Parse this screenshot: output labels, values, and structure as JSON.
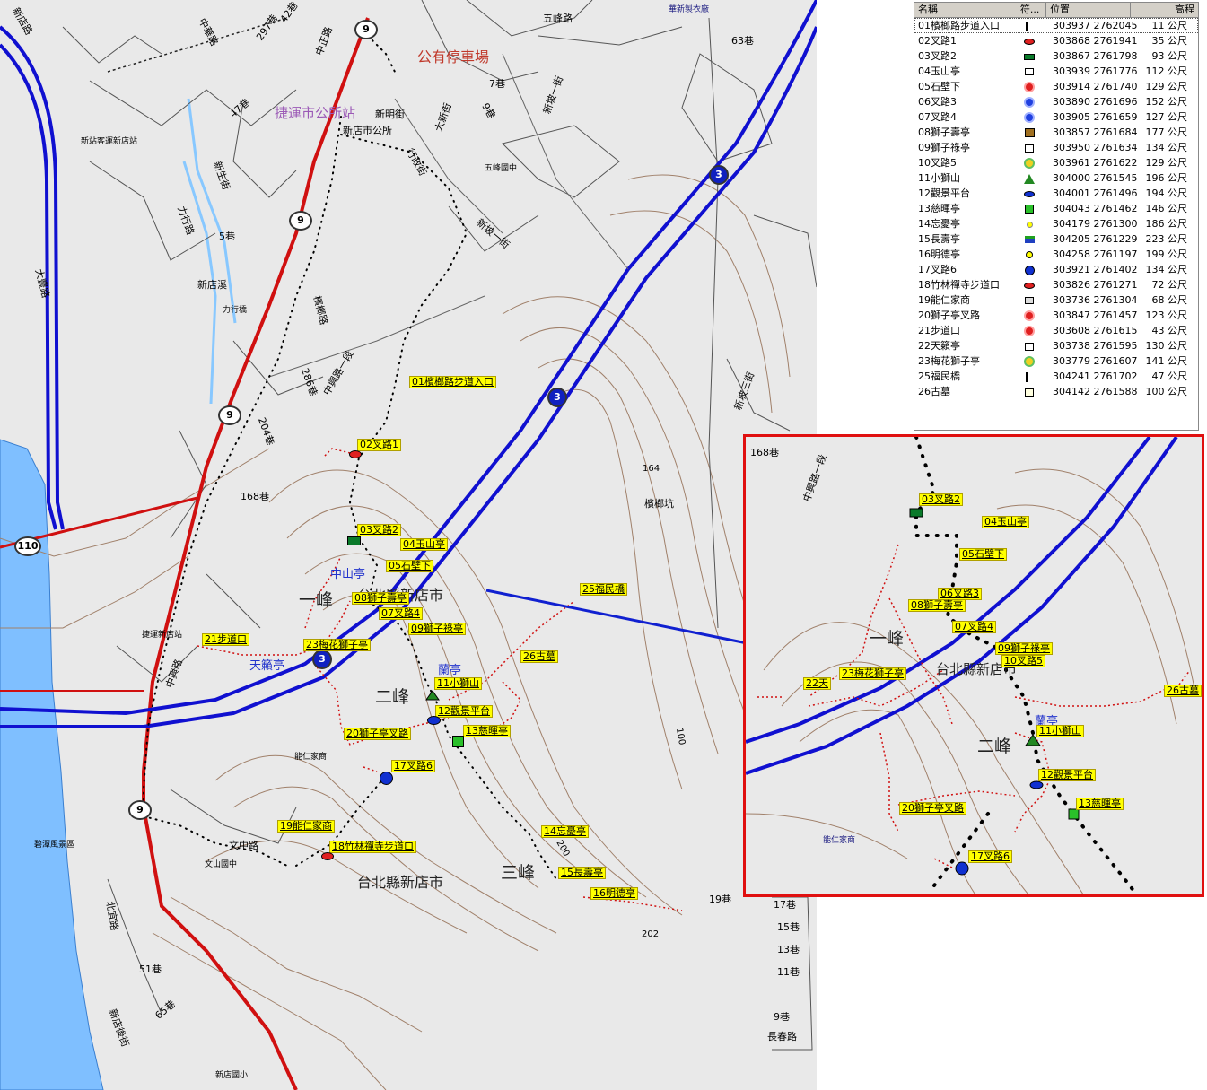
{
  "legend": {
    "headers": [
      "名稱",
      "符...",
      "位置",
      "高程"
    ],
    "rows": [
      {
        "name": "01檳榔路步道入口",
        "pos": "303937 2762045",
        "elev": "11 公尺",
        "icon": "hiker-icon"
      },
      {
        "name": "02叉路1",
        "pos": "303868 2761941",
        "elev": "35 公尺",
        "icon": "red-oval-icon"
      },
      {
        "name": "03叉路2",
        "pos": "303867 2761798",
        "elev": "93 公尺",
        "icon": "green-rect-icon"
      },
      {
        "name": "04玉山亭",
        "pos": "303939 2761776",
        "elev": "112 公尺",
        "icon": "pavilion-icon"
      },
      {
        "name": "05石壁下",
        "pos": "303914 2761740",
        "elev": "129 公尺",
        "icon": "red-sun-icon"
      },
      {
        "name": "06叉路3",
        "pos": "303890 2761696",
        "elev": "152 公尺",
        "icon": "blue-sun-icon"
      },
      {
        "name": "07叉路4",
        "pos": "303905 2761659",
        "elev": "127 公尺",
        "icon": "blue-sun-icon"
      },
      {
        "name": "08獅子壽亭",
        "pos": "303857 2761684",
        "elev": "177 公尺",
        "icon": "house-icon"
      },
      {
        "name": "09獅子祿亭",
        "pos": "303950 2761634",
        "elev": "134 公尺",
        "icon": "temple-icon"
      },
      {
        "name": "10叉路5",
        "pos": "303961 2761622",
        "elev": "129 公尺",
        "icon": "green-sun-icon"
      },
      {
        "name": "11小獅山",
        "pos": "304000 2761545",
        "elev": "196 公尺",
        "icon": "green-triangle-icon"
      },
      {
        "name": "12觀景平台",
        "pos": "304001 2761496",
        "elev": "194 公尺",
        "icon": "blue-oval-icon"
      },
      {
        "name": "13慈暉亭",
        "pos": "304043 2761462",
        "elev": "146 公尺",
        "icon": "green-cube-icon"
      },
      {
        "name": "14忘憂亭",
        "pos": "304179 2761300",
        "elev": "186 公尺",
        "icon": "yellow-dot-icon"
      },
      {
        "name": "15長壽亭",
        "pos": "304205 2761229",
        "elev": "223 公尺",
        "icon": "green-house-icon"
      },
      {
        "name": "16明德亭",
        "pos": "304258 2761197",
        "elev": "199 公尺",
        "icon": "yellow-circle-icon"
      },
      {
        "name": "17叉路6",
        "pos": "303921 2761402",
        "elev": "134 公尺",
        "icon": "blue-dot-icon"
      },
      {
        "name": "18竹林禪寺步道口",
        "pos": "303826 2761271",
        "elev": "72 公尺",
        "icon": "red-oval-icon"
      },
      {
        "name": "19能仁家商",
        "pos": "303736 2761304",
        "elev": "68 公尺",
        "icon": "school-icon"
      },
      {
        "name": "20獅子亭叉路",
        "pos": "303847 2761457",
        "elev": "123 公尺",
        "icon": "red-sun-icon"
      },
      {
        "name": "21步道口",
        "pos": "303608 2761615",
        "elev": "43 公尺",
        "icon": "red-sun-icon"
      },
      {
        "name": "22天籟亭",
        "pos": "303738 2761595",
        "elev": "130 公尺",
        "icon": "temple-icon"
      },
      {
        "name": "23梅花獅子亭",
        "pos": "303779 2761607",
        "elev": "141 公尺",
        "icon": "green-sun-icon"
      },
      {
        "name": "25福民橋",
        "pos": "304241 2761702",
        "elev": "47 公尺",
        "icon": "hiker-icon"
      },
      {
        "name": "26古墓",
        "pos": "304142 2761588",
        "elev": "100 公尺",
        "icon": "tomb-icon"
      }
    ]
  },
  "map": {
    "waypoints": [
      "01檳榔路步道入口",
      "02叉路1",
      "03叉路2",
      "04玉山亭",
      "05石壁下",
      "06叉路3",
      "07叉路4",
      "08獅子壽亭",
      "09獅子祿亭",
      "10叉路5",
      "11小獅山",
      "12觀景平台",
      "13慈暉亭",
      "14忘憂亭",
      "15長壽亭",
      "16明德亭",
      "17叉路6",
      "18竹林禪寺步道口",
      "19能仁家商",
      "20獅子亭叉路",
      "21步道口",
      "23梅花獅子亭",
      "25福民橋",
      "26古墓"
    ],
    "peaks": [
      "一峰",
      "二峰",
      "三峰"
    ],
    "city": "台北縣新店市",
    "parking": "公有停車場",
    "mrt_station": "捷運市公所站",
    "pavilions": [
      "中山亭",
      "天籟亭",
      "蘭亭"
    ],
    "streets": [
      "新店路",
      "中華路",
      "297巷",
      "42巷",
      "中正路",
      "五峰路",
      "行政街",
      "新明街",
      "大新街",
      "新店市公所",
      "新坡一街",
      "新站客運新店站",
      "五峰國中",
      "新生街",
      "力行路",
      "新店溪",
      "力行橋",
      "大豐路",
      "檳榔路",
      "中興路一段",
      "286巷",
      "204巷",
      "168巷",
      "檳榔坑",
      "捷運新店站",
      "能仁家商",
      "文中路",
      "文山國中",
      "北宜路",
      "中興路",
      "新店後街",
      "新店國小",
      "碧潭風景區",
      "19巷",
      "17巷",
      "15巷",
      "13巷",
      "11巷",
      "9巷",
      "長春路",
      "65巷",
      "51巷",
      "5巷",
      "47巷",
      "7巷",
      "9巷",
      "63巷",
      "華新製衣廠",
      "新坡一街",
      "新坡三街"
    ],
    "heights": [
      "164",
      "100",
      "200",
      "202"
    ],
    "route_shields": [
      "9",
      "9",
      "9",
      "9",
      "3",
      "3",
      "3",
      "110"
    ]
  },
  "inset": {
    "labels": [
      "03叉路2",
      "04玉山亭",
      "05石壁下",
      "06叉路3",
      "08獅子壽亭",
      "07叉路4",
      "09獅子祿亭",
      "10叉路5",
      "22天",
      "23梅花獅子亭",
      "11小獅山",
      "12觀景平台",
      "13慈暉亭",
      "20獅子亭叉路",
      "17叉路6",
      "26古墓"
    ],
    "peaks": [
      "一峰",
      "二峰"
    ],
    "texts": [
      "168巷",
      "中興路一段",
      "台北縣新店市",
      "蘭亭",
      "能仁家商"
    ]
  },
  "colors": {
    "trail": "#000000",
    "trail_dashed": "#d01010",
    "highway": "#1010d0",
    "road": "#d01010",
    "river": "#7fbfff",
    "contour": "#a0806a",
    "highlight": "#ffff00"
  }
}
